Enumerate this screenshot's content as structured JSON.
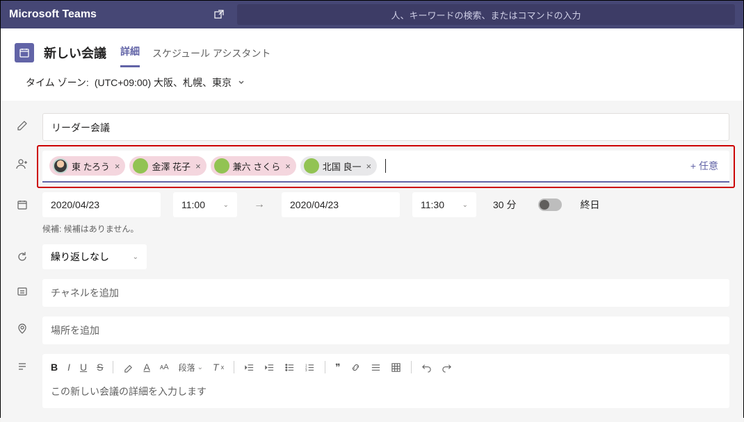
{
  "topbar": {
    "app_title": "Microsoft Teams",
    "search_placeholder": "人、キーワードの検索、またはコマンドの入力"
  },
  "header": {
    "title": "新しい会議",
    "tabs": {
      "details": "詳細",
      "scheduling": "スケジュール アシスタント"
    }
  },
  "timezone": {
    "label": "タイム ゾーン:",
    "value": "(UTC+09:00) 大阪、札幌、東京"
  },
  "meeting": {
    "title": "リーダー会議",
    "attendees": [
      {
        "name": "東 たろう",
        "color": "pink",
        "avatar": "img"
      },
      {
        "name": "金澤 花子",
        "color": "pink",
        "avatar": "green"
      },
      {
        "name": "兼六 さくら",
        "color": "pink",
        "avatar": "green"
      },
      {
        "name": "北国 良一",
        "color": "gray",
        "avatar": "green"
      }
    ],
    "optional_label": "+ 任意",
    "start_date": "2020/04/23",
    "start_time": "11:00",
    "end_date": "2020/04/23",
    "end_time": "11:30",
    "duration": "30 分",
    "all_day": "終日",
    "suggestions_label": "候補:",
    "suggestions_value": "候補はありません。",
    "recurrence": "繰り返しなし",
    "channel_placeholder": "チャネルを追加",
    "location_placeholder": "場所を追加",
    "details_placeholder": "この新しい会議の詳細を入力します"
  },
  "rte": {
    "paragraph_label": "段落"
  }
}
